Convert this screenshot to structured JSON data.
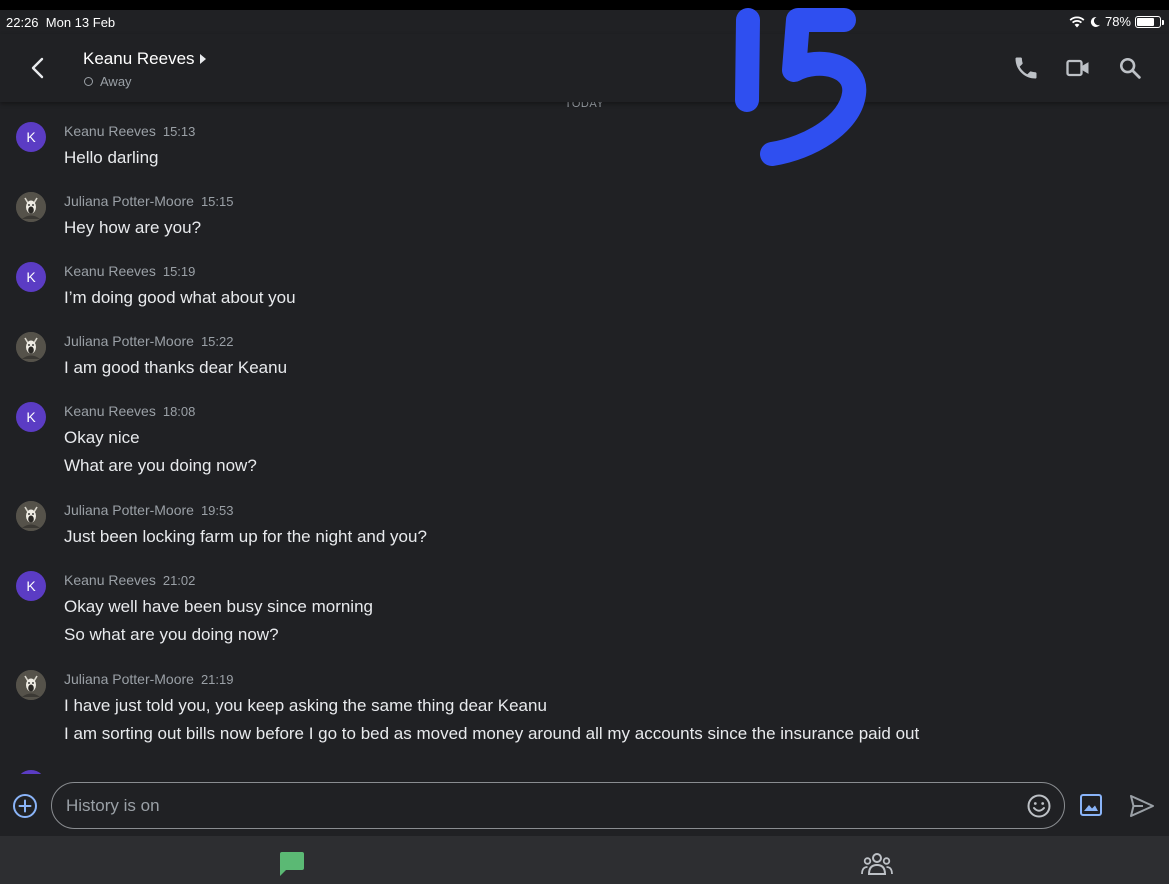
{
  "status_bar": {
    "time": "22:26",
    "date": "Mon 13 Feb",
    "battery": "78%",
    "battery_level": 0.78
  },
  "header": {
    "contact_name": "Keanu Reeves",
    "presence": "Away"
  },
  "separator": "TODAY",
  "messages": [
    {
      "sender": "Keanu Reeves",
      "time": "15:13",
      "avatar": "K",
      "lines": [
        "Hello darling"
      ]
    },
    {
      "sender": "Juliana Potter-Moore",
      "time": "15:15",
      "avatar": "",
      "lines": [
        "Hey how are you?"
      ]
    },
    {
      "sender": "Keanu Reeves",
      "time": "15:19",
      "avatar": "K",
      "lines": [
        "I’m doing good what about you"
      ]
    },
    {
      "sender": "Juliana Potter-Moore",
      "time": "15:22",
      "avatar": "",
      "lines": [
        "I am good thanks dear Keanu"
      ]
    },
    {
      "sender": "Keanu Reeves",
      "time": "18:08",
      "avatar": "K",
      "lines": [
        "Okay nice",
        "What are you doing now?"
      ]
    },
    {
      "sender": "Juliana Potter-Moore",
      "time": "19:53",
      "avatar": "",
      "lines": [
        "Just been locking farm up for the night and you?"
      ]
    },
    {
      "sender": "Keanu Reeves",
      "time": "21:02",
      "avatar": "K",
      "lines": [
        "Okay well have been busy since morning",
        "So what are you doing now?"
      ]
    },
    {
      "sender": "Juliana Potter-Moore",
      "time": "21:19",
      "avatar": "",
      "lines": [
        "I have just told you, you keep asking the same thing dear Keanu",
        "I am sorting out bills now before I go to bed as moved money around all my accounts since the insurance paid out"
      ]
    }
  ],
  "composer": {
    "placeholder": "History is on",
    "value": ""
  },
  "annotation": {
    "text": "15",
    "color": "#2f4ff0"
  },
  "colors": {
    "background": "#202124",
    "avatar": "#5b3cc4",
    "accent": "#8ab4f8",
    "chat_tab": "#5bb974"
  },
  "icons": {
    "back": "chevron-left-icon",
    "call": "phone-icon",
    "video": "video-camera-icon",
    "search": "search-icon",
    "add": "plus-circle-icon",
    "emoji": "emoji-icon",
    "image": "image-icon",
    "send": "send-icon",
    "chat_tab": "chat-icon",
    "people_tab": "people-icon"
  }
}
